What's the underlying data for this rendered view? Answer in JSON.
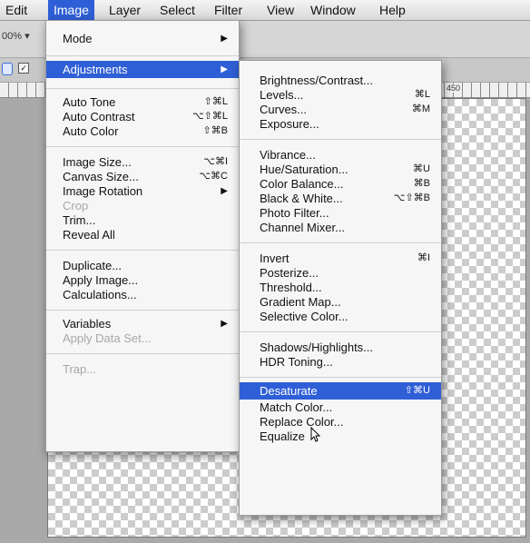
{
  "menubar": {
    "items": [
      "Edit",
      "Image",
      "Layer",
      "Select",
      "Filter",
      "View",
      "Window",
      "Help"
    ]
  },
  "optbar": {
    "zoom": "00% ▾"
  },
  "ruler": {
    "ticks": [
      "450"
    ]
  },
  "image_menu": {
    "items": [
      {
        "label": "Mode",
        "shortcut": "",
        "submenu": true
      },
      {
        "label": "Adjustments",
        "shortcut": "",
        "submenu": true,
        "highlighted": true
      },
      {
        "label": "Auto Tone",
        "shortcut": "⇧⌘L"
      },
      {
        "label": "Auto Contrast",
        "shortcut": "⌥⇧⌘L"
      },
      {
        "label": "Auto Color",
        "shortcut": "⇧⌘B"
      },
      {
        "label": "Image Size...",
        "shortcut": "⌥⌘I"
      },
      {
        "label": "Canvas Size...",
        "shortcut": "⌥⌘C"
      },
      {
        "label": "Image Rotation",
        "shortcut": "",
        "submenu": true
      },
      {
        "label": "Crop",
        "disabled": true
      },
      {
        "label": "Trim..."
      },
      {
        "label": "Reveal All"
      },
      {
        "label": "Duplicate..."
      },
      {
        "label": "Apply Image..."
      },
      {
        "label": "Calculations..."
      },
      {
        "label": "Variables",
        "submenu": true
      },
      {
        "label": "Apply Data Set...",
        "disabled": true
      },
      {
        "label": "Trap...",
        "disabled": true
      }
    ]
  },
  "adjust_menu": {
    "items": [
      {
        "label": "Brightness/Contrast...",
        "shortcut": ""
      },
      {
        "label": "Levels...",
        "shortcut": "⌘L"
      },
      {
        "label": "Curves...",
        "shortcut": "⌘M"
      },
      {
        "label": "Exposure...",
        "shortcut": ""
      },
      {
        "label": "Vibrance...",
        "shortcut": ""
      },
      {
        "label": "Hue/Saturation...",
        "shortcut": "⌘U"
      },
      {
        "label": "Color Balance...",
        "shortcut": "⌘B"
      },
      {
        "label": "Black & White...",
        "shortcut": "⌥⇧⌘B"
      },
      {
        "label": "Photo Filter...",
        "shortcut": ""
      },
      {
        "label": "Channel Mixer...",
        "shortcut": ""
      },
      {
        "label": "Invert",
        "shortcut": "⌘I"
      },
      {
        "label": "Posterize...",
        "shortcut": ""
      },
      {
        "label": "Threshold...",
        "shortcut": ""
      },
      {
        "label": "Gradient Map...",
        "shortcut": ""
      },
      {
        "label": "Selective Color...",
        "shortcut": ""
      },
      {
        "label": "Shadows/Highlights...",
        "shortcut": ""
      },
      {
        "label": "HDR Toning...",
        "shortcut": ""
      },
      {
        "label": "Desaturate",
        "shortcut": "⇧⌘U",
        "highlighted": true
      },
      {
        "label": "Match Color...",
        "shortcut": ""
      },
      {
        "label": "Replace Color...",
        "shortcut": ""
      },
      {
        "label": "Equalize",
        "shortcut": ""
      }
    ]
  },
  "colors": {
    "highlight": "#2f5fd6",
    "menu_bg": "#f6f6f6",
    "disabled_text": "#a6a6a6"
  },
  "icons": {
    "cursor": "arrow-cursor-icon"
  }
}
